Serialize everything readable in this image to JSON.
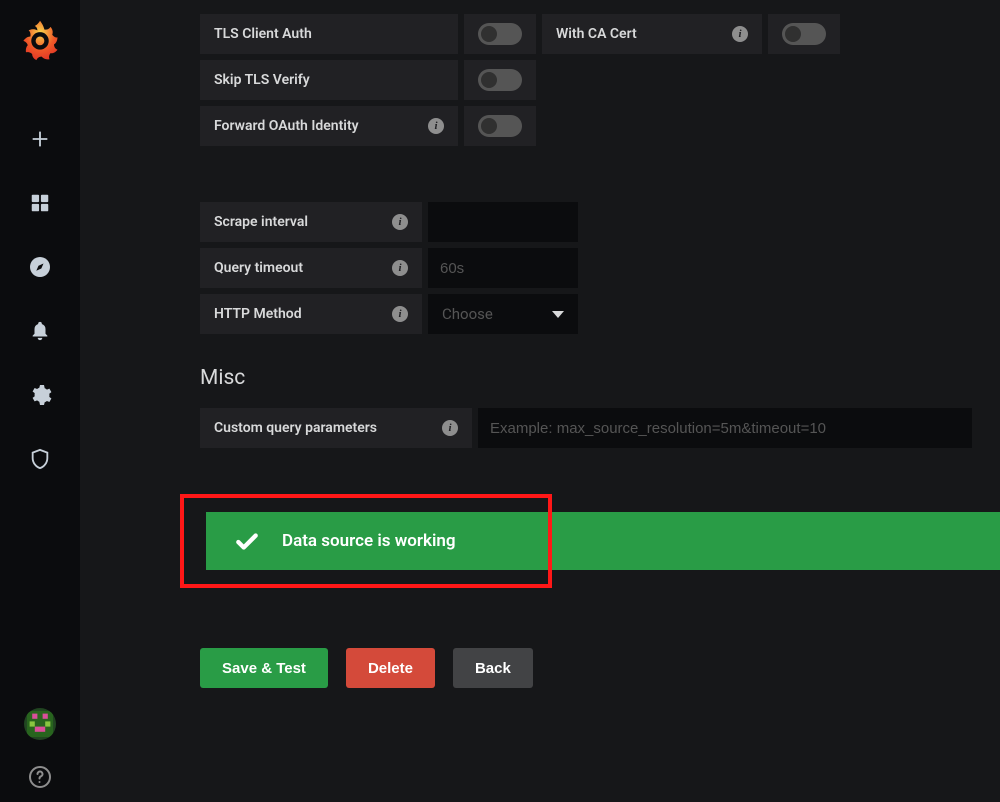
{
  "sidebar": {
    "nav": [
      "plus",
      "apps",
      "compass",
      "bell",
      "gear",
      "shield"
    ]
  },
  "auth": {
    "tls_client_auth": {
      "label": "TLS Client Auth"
    },
    "with_ca_cert": {
      "label": "With CA Cert"
    },
    "skip_tls_verify": {
      "label": "Skip TLS Verify"
    },
    "forward_oauth": {
      "label": "Forward OAuth Identity"
    }
  },
  "query": {
    "scrape_interval": {
      "label": "Scrape interval",
      "value": ""
    },
    "query_timeout": {
      "label": "Query timeout",
      "placeholder": "60s",
      "value": ""
    },
    "http_method": {
      "label": "HTTP Method",
      "placeholder": "Choose"
    }
  },
  "misc": {
    "title": "Misc",
    "custom_params": {
      "label": "Custom query parameters",
      "placeholder": "Example: max_source_resolution=5m&timeout=10",
      "value": ""
    }
  },
  "status": {
    "message": "Data source is working"
  },
  "buttons": {
    "save": "Save & Test",
    "delete": "Delete",
    "back": "Back"
  }
}
